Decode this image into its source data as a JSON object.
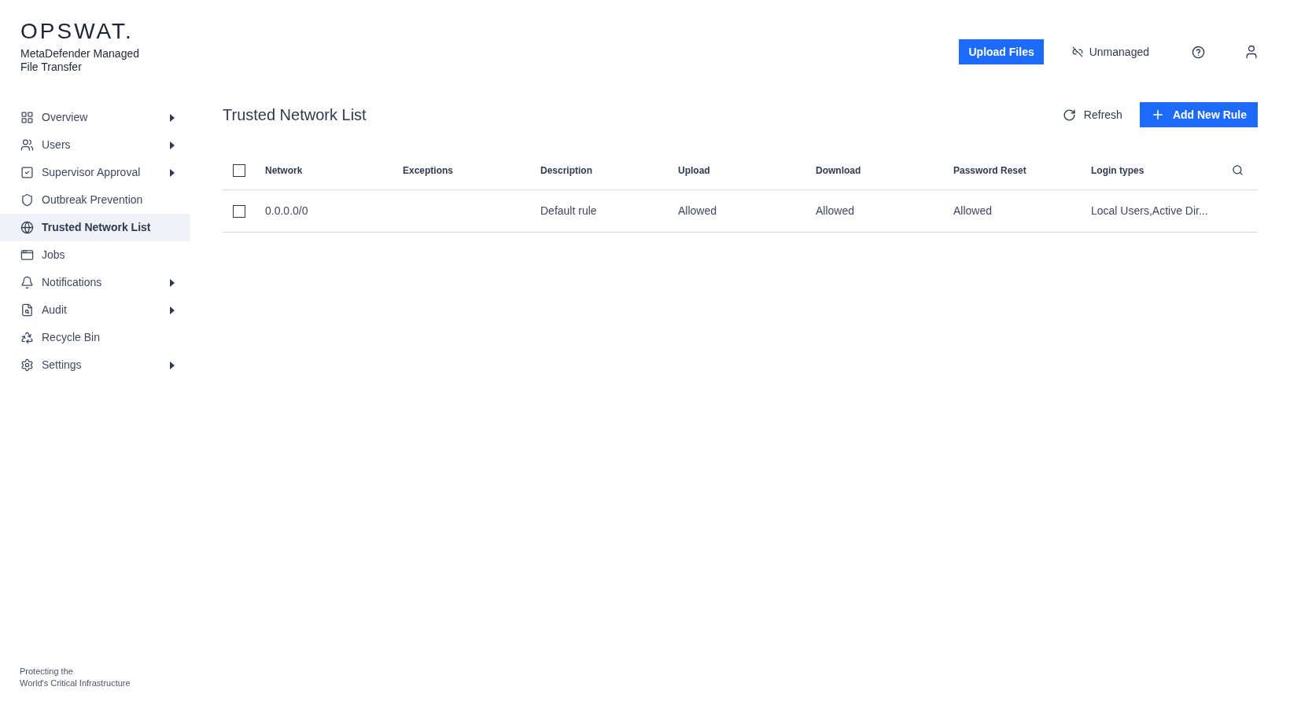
{
  "brand": {
    "logo": "OPSWAT.",
    "product": "MetaDefender Managed File Transfer",
    "tagline_lines": [
      "Protecting the",
      "World's Critical Infrastructure"
    ]
  },
  "header": {
    "upload_button": "Upload Files",
    "status_link": "Unmanaged"
  },
  "sidebar": {
    "items": [
      {
        "label": "Overview",
        "has_submenu": true,
        "selected": false
      },
      {
        "label": "Users",
        "has_submenu": true,
        "selected": false
      },
      {
        "label": "Supervisor Approval",
        "has_submenu": true,
        "selected": false
      },
      {
        "label": "Outbreak Prevention",
        "has_submenu": false,
        "selected": false
      },
      {
        "label": "Trusted Network List",
        "has_submenu": false,
        "selected": true
      },
      {
        "label": "Jobs",
        "has_submenu": false,
        "selected": false
      },
      {
        "label": "Notifications",
        "has_submenu": true,
        "selected": false
      },
      {
        "label": "Audit",
        "has_submenu": true,
        "selected": false
      },
      {
        "label": "Recycle Bin",
        "has_submenu": false,
        "selected": false
      },
      {
        "label": "Settings",
        "has_submenu": true,
        "selected": false
      }
    ]
  },
  "page": {
    "title": "Trusted Network List",
    "refresh_button": "Refresh",
    "add_button": "Add New Rule"
  },
  "table": {
    "all_checked": false,
    "columns": [
      "Network",
      "Exceptions",
      "Description",
      "Upload",
      "Download",
      "Password Reset",
      "Login types"
    ],
    "rows": [
      {
        "checked": false,
        "cells": [
          "0.0.0.0/0",
          "",
          "Default rule",
          "Allowed",
          "Allowed",
          "Allowed",
          "Local Users,Active Dir..."
        ]
      }
    ]
  }
}
